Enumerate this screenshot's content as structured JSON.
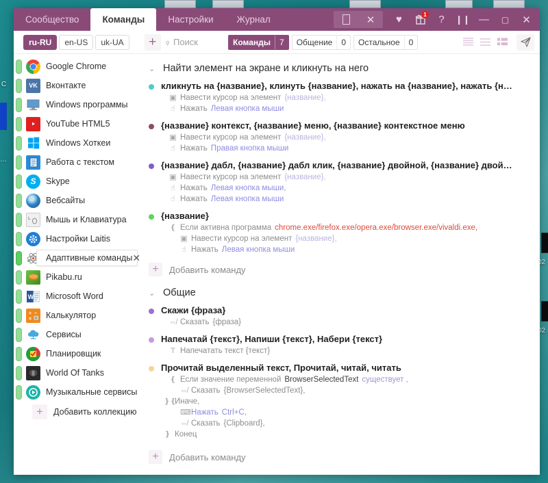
{
  "window": {
    "tabs": [
      {
        "label": "Сообщество",
        "active": false
      },
      {
        "label": "Команды",
        "active": true
      },
      {
        "label": "Настройки",
        "active": false
      },
      {
        "label": "Журнал",
        "active": false
      }
    ],
    "controls": {
      "pin": "pin-icon",
      "close_pin": "✕",
      "heart": "♥",
      "gift": "gift-icon",
      "gift_badge": "1",
      "help": "?",
      "pause": "❙❙",
      "minimize": "—",
      "maximize": "▢",
      "close": "✕"
    },
    "accent_color": "#8a4a78",
    "desktop_color": "#1c8a8e"
  },
  "toolbar": {
    "languages": [
      {
        "code": "ru-RU",
        "active": true
      },
      {
        "code": "en-US",
        "active": false
      },
      {
        "code": "uk-UA",
        "active": false
      }
    ],
    "add_label": "+",
    "search": {
      "placeholder": "Поиск",
      "value": ""
    },
    "filters": [
      {
        "label": "Команды",
        "count": "7",
        "active": true
      },
      {
        "label": "Общение",
        "count": "0",
        "active": false
      },
      {
        "label": "Остальное",
        "count": "0",
        "active": false
      }
    ],
    "view_modes": [
      "list-compact-icon",
      "list-normal-icon",
      "list-detail-icon"
    ],
    "send_icon": "send-icon"
  },
  "sidebar": {
    "collections": [
      {
        "name": "Google Chrome",
        "icon": "chrome",
        "selected": false
      },
      {
        "name": "Вконтакте",
        "icon": "vk",
        "selected": false
      },
      {
        "name": "Windows программы",
        "icon": "monitor",
        "selected": false
      },
      {
        "name": "YouTube HTML5",
        "icon": "youtube",
        "selected": false
      },
      {
        "name": "Windows Хоткеи",
        "icon": "windows",
        "selected": false
      },
      {
        "name": "Работа с текстом",
        "icon": "document",
        "selected": false
      },
      {
        "name": "Skype",
        "icon": "skype",
        "selected": false
      },
      {
        "name": "Вебсайты",
        "icon": "globe",
        "selected": false
      },
      {
        "name": "Мышь и Клавиатура",
        "icon": "mouse-key",
        "selected": false
      },
      {
        "name": "Настройки Laitis",
        "icon": "gear",
        "selected": false
      },
      {
        "name": "Адаптивные команды",
        "icon": "atom",
        "selected": true
      },
      {
        "name": "Pikabu.ru",
        "icon": "pikabu",
        "selected": false
      },
      {
        "name": "Microsoft Word",
        "icon": "word",
        "selected": false
      },
      {
        "name": "Калькулятор",
        "icon": "calc",
        "selected": false
      },
      {
        "name": "Сервисы",
        "icon": "cloud",
        "selected": false
      },
      {
        "name": "Планировщик",
        "icon": "planner",
        "selected": false
      },
      {
        "name": "World Of Tanks",
        "icon": "wot",
        "selected": false
      },
      {
        "name": "Музыкальные сервисы",
        "icon": "play",
        "selected": false
      }
    ],
    "selected_close_icon": "✕",
    "add_collection_label": "Добавить коллекцию"
  },
  "content": {
    "groups": [
      {
        "title": "Найти элемент на экране и кликнуть на него",
        "commands": [
          {
            "dot_color": "#4ecdc4",
            "title": "кликнуть на {название}, клинуть {название}, нажать на {название}, нажать {название}",
            "steps": [
              {
                "icon": "cursor-icon",
                "indent": 0,
                "text": "Навести курсор на элемент",
                "arg": "{название},"
              },
              {
                "icon": "click-icon",
                "indent": 0,
                "text": "Нажать",
                "key": "Левая кнопка мыши"
              }
            ]
          },
          {
            "dot_color": "#8d4f5c",
            "title": "{название} контекст, {название} меню, {название} контекстное меню",
            "steps": [
              {
                "icon": "cursor-icon",
                "indent": 0,
                "text": "Навести курсор на элемент",
                "arg": "{название},"
              },
              {
                "icon": "click-icon",
                "indent": 0,
                "text": "Нажать",
                "key": "Правая кнопка мыши"
              }
            ]
          },
          {
            "dot_color": "#7d5fc4",
            "title": "{название} дабл, {название} дабл клик, {название} двойной, {название} двойной клик, д…",
            "steps": [
              {
                "icon": "cursor-icon",
                "indent": 0,
                "text": "Навести курсор на элемент",
                "arg": "{название},"
              },
              {
                "icon": "click-icon",
                "indent": 0,
                "text": "Нажать",
                "key": "Левая кнопка мыши,"
              },
              {
                "icon": "click-icon",
                "indent": 0,
                "text": "Нажать",
                "key": "Левая кнопка мыши"
              }
            ]
          },
          {
            "dot_color": "#5fd35f",
            "title": "{название}",
            "steps": [
              {
                "icon": "brace-icon",
                "indent": 0,
                "text": "Если активна программа",
                "lit": "chrome.exe/firefox.exe/opera.exe/browser.exe/vivaldi.exe,"
              },
              {
                "icon": "cursor-icon",
                "indent": 1,
                "text": "Навести курсор на элемент",
                "arg": "{название},"
              },
              {
                "icon": "click-icon",
                "indent": 1,
                "text": "Нажать",
                "key": "Левая кнопка мыши"
              }
            ]
          }
        ],
        "add_command_label": "Добавить команду"
      },
      {
        "title": "Общие",
        "commands": [
          {
            "dot_color": "#9b6fd4",
            "title": "Скажи {фраза}",
            "steps": [
              {
                "icon": "speak-icon",
                "indent": 0,
                "text": "Сказать",
                "arg2": "{фраза}"
              }
            ]
          },
          {
            "dot_color": "#c79ae0",
            "title": "Напечатай {текст}, Напиши {текст}, Набери {текст}",
            "steps": [
              {
                "icon": "type-icon",
                "indent": 0,
                "text": "Напечатать текст {текст}"
              }
            ]
          },
          {
            "dot_color": "#f2d69a",
            "title": "Прочитай выделенный текст, Прочитай, читай, читать",
            "steps": [
              {
                "icon": "brace-icon",
                "indent": 0,
                "text": "Если значение переменной",
                "plain": "BrowserSelectedText",
                "ex": "существует ,"
              },
              {
                "icon": "speak-icon",
                "indent": 1,
                "text": "Сказать",
                "arg2": "{BrowserSelectedText},"
              },
              {
                "icon": "brace-close-icon",
                "indent": 0,
                "text": "Иначе,"
              },
              {
                "icon": "hotkey-icon",
                "indent": 1,
                "text": "Нажать",
                "key": "Ctrl+C,"
              },
              {
                "icon": "speak-icon",
                "indent": 1,
                "text": "Сказать",
                "arg2": "{Clipboard},"
              },
              {
                "icon": "brace-end-icon",
                "indent": 0,
                "text": "Конец"
              }
            ]
          }
        ],
        "add_command_label": "Добавить команду"
      }
    ]
  }
}
